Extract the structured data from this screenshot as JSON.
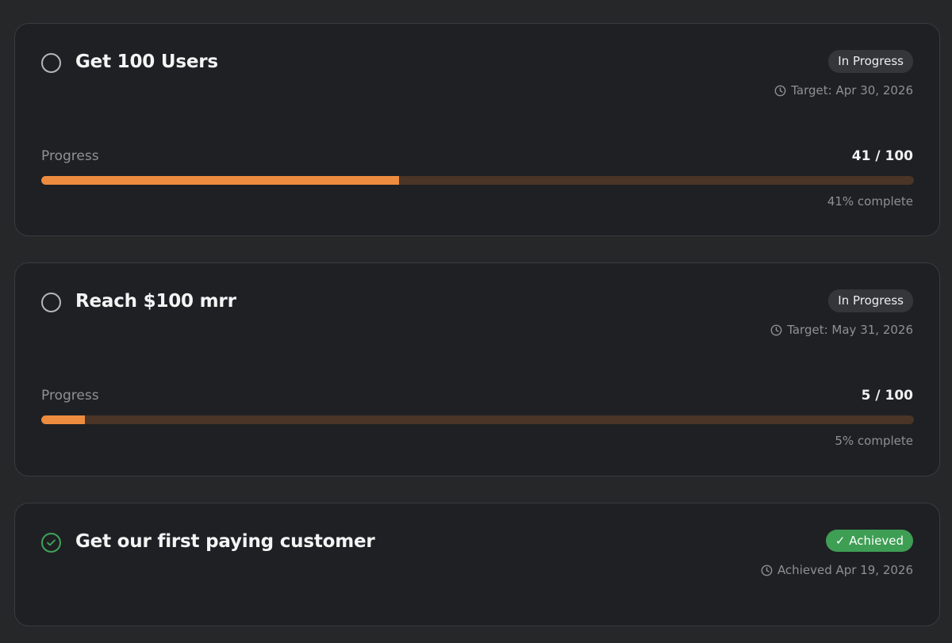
{
  "goals": [
    {
      "title": "Get 100 Users",
      "status": "In Progress",
      "date_text": "Target: Apr 30, 2026",
      "progress_label": "Progress",
      "progress_count": "41 / 100",
      "progress_fraction": 0.41,
      "percent_text": "41% complete"
    },
    {
      "title": "Reach $100 mrr",
      "status": "In Progress",
      "date_text": "Target: May 31, 2026",
      "progress_label": "Progress",
      "progress_count": "5 / 100",
      "progress_fraction": 0.05,
      "percent_text": "5% complete"
    },
    {
      "title": "Get our first paying customer",
      "status": "✓ Achieved",
      "date_text": "Achieved Apr 19, 2026"
    }
  ],
  "colors": {
    "accent": "#ed8c3f",
    "track": "#4a3526",
    "achieved": "#3e9e54",
    "card_bg": "#1f2023",
    "page_bg": "#262729"
  },
  "icons": {
    "status_open": "circle-outline-icon",
    "status_done": "check-circle-icon",
    "date": "clock-icon"
  }
}
